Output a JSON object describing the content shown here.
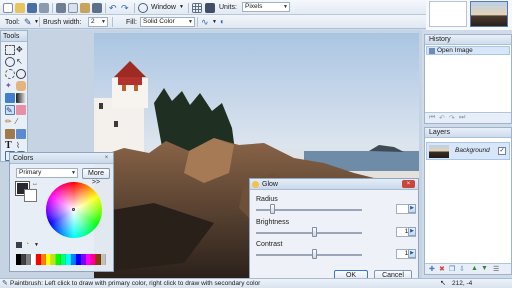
{
  "toolbar_top": {
    "window_label": "Window",
    "units_label": "Units:",
    "units_value": "Pixels"
  },
  "toolbar_second": {
    "tool_label": "Tool:",
    "brush_width_label": "Brush width:",
    "brush_width_value": "2",
    "fill_label": "Fill:",
    "fill_value": "Solid Color"
  },
  "tools_panel": {
    "title": "Tools"
  },
  "colors_panel": {
    "title": "Colors",
    "mode_value": "Primary",
    "more_label": "More >>",
    "palette": [
      "#000000",
      "#404040",
      "#7f7f7f",
      "#ffffff",
      "#ff0000",
      "#ff7f00",
      "#ffff00",
      "#b5e61d",
      "#00ff00",
      "#00ff7f",
      "#00ffff",
      "#007fff",
      "#0000ff",
      "#7f00ff",
      "#ff00ff",
      "#ff007f",
      "#7f3f00",
      "#c0c0c0"
    ]
  },
  "history_panel": {
    "title": "History",
    "items": [
      "Open Image"
    ]
  },
  "layers_panel": {
    "title": "Layers",
    "layers": [
      {
        "name": "Background",
        "visible_check": "✓"
      }
    ]
  },
  "glow_dialog": {
    "title": "Glow",
    "close_glyph": "×",
    "params": [
      {
        "label": "Radius",
        "value": "3",
        "level": 0.15
      },
      {
        "label": "Brightness",
        "value": "10",
        "level": 0.55
      },
      {
        "label": "Contrast",
        "value": "10",
        "level": 0.55
      }
    ],
    "ok_label": "OK",
    "cancel_label": "Cancel"
  },
  "status_bar": {
    "message": "Paintbrush: Left click to draw with primary color, right click to draw with secondary color",
    "coords": "212, -4"
  },
  "colors": {
    "accent": "#3b78c4",
    "dialog_close": "#c9463d",
    "selection": "#d7e6f8"
  }
}
